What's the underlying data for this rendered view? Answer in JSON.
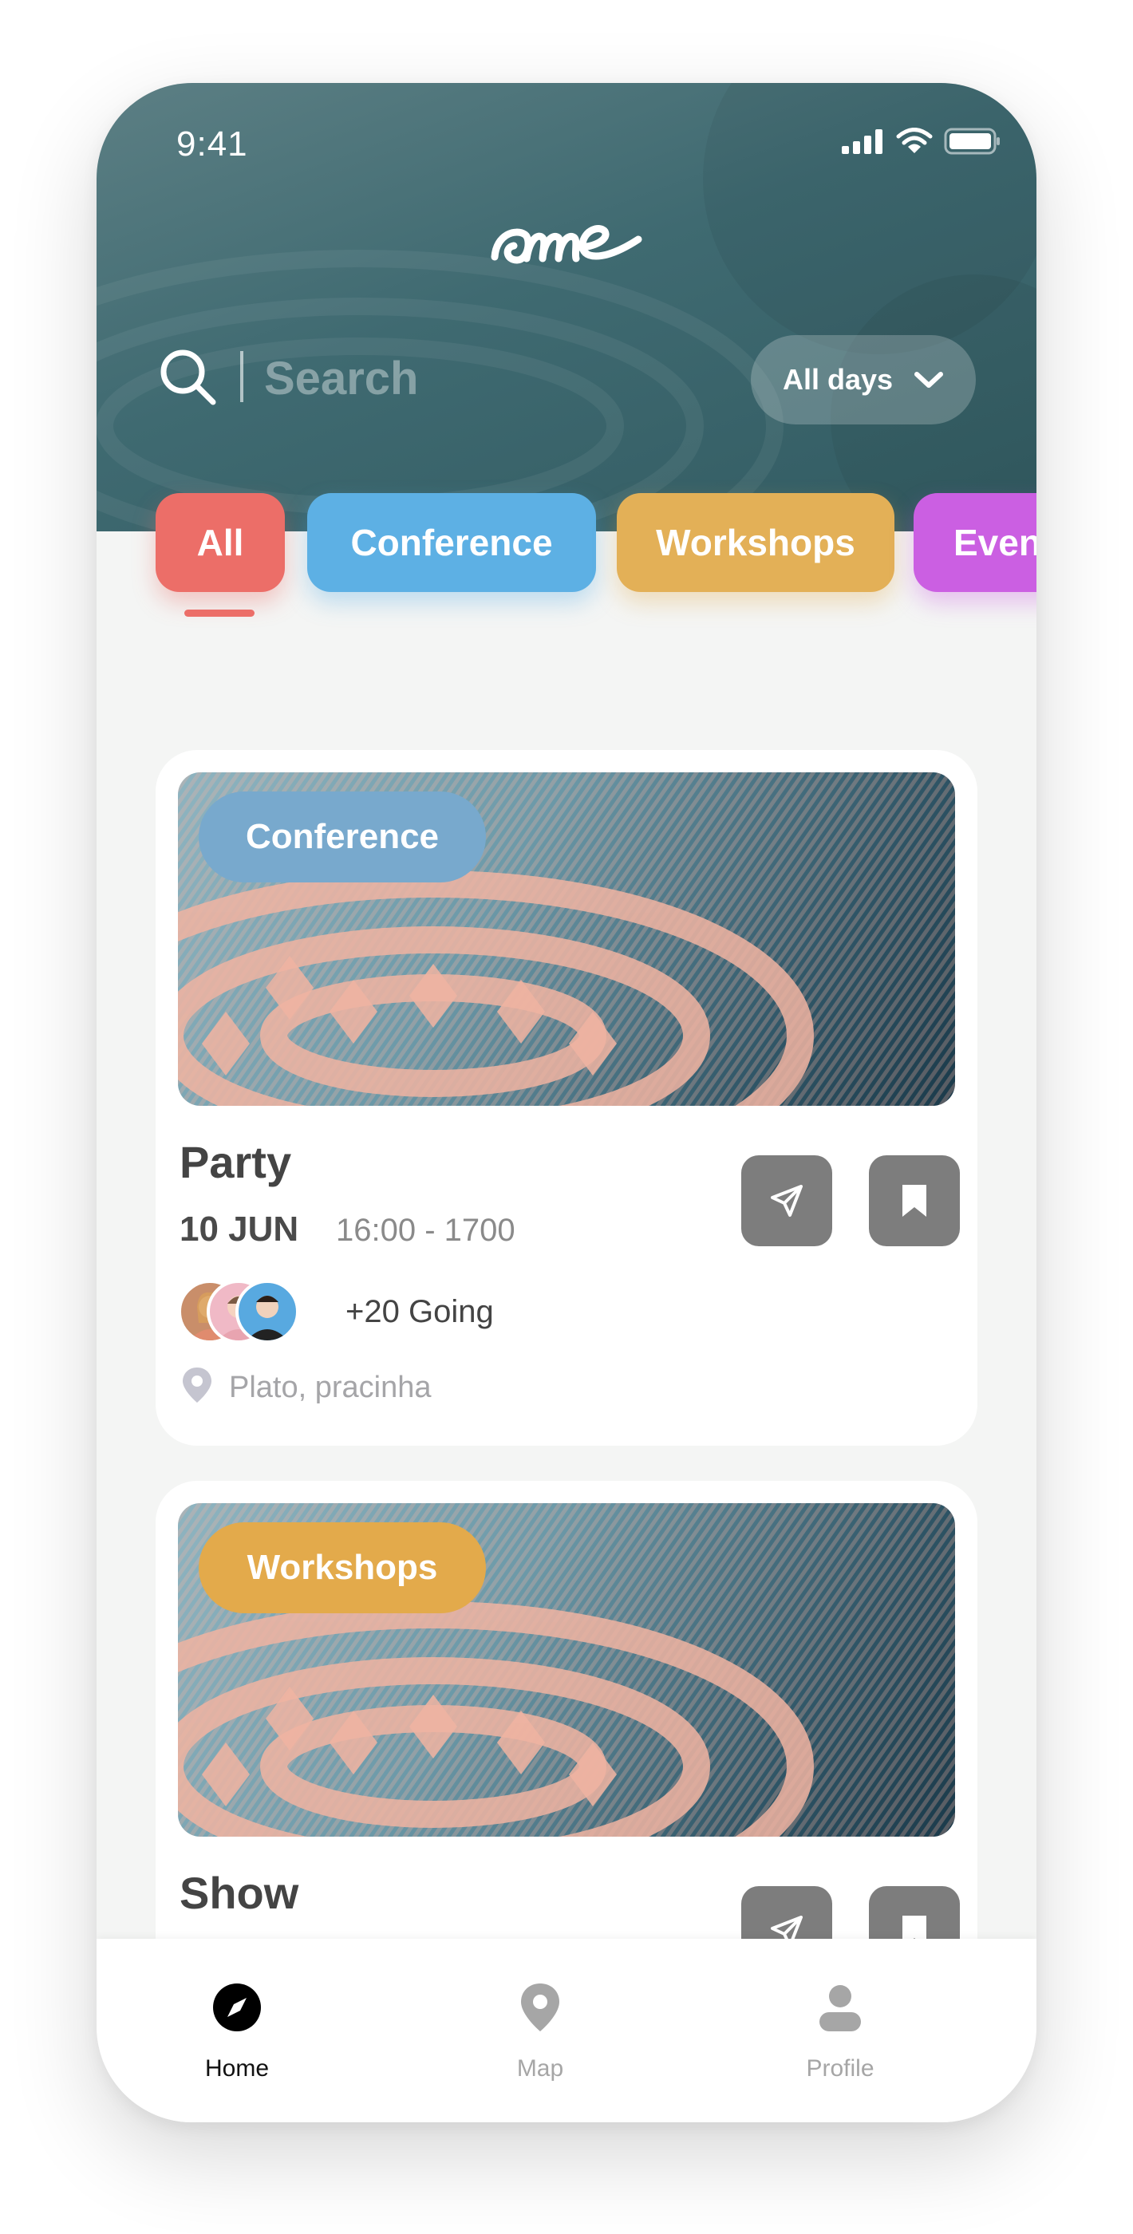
{
  "status_bar": {
    "time": "9:41"
  },
  "header": {
    "logo_text": "ame",
    "search": {
      "placeholder": "Search",
      "value": ""
    },
    "days_filter": {
      "label": "All days"
    }
  },
  "categories": [
    {
      "label": "All",
      "color": "#ec6e68",
      "selected": true
    },
    {
      "label": "Conference",
      "color": "#5db0e4"
    },
    {
      "label": "Workshops",
      "color": "#e3b057"
    },
    {
      "label": "Events",
      "color": "#cb5fe2"
    }
  ],
  "events": [
    {
      "category": "Conference",
      "title": "Party",
      "date": "10 JUN",
      "time": "16:00 - 1700",
      "going": "+20 Going",
      "location": "Plato, pracinha",
      "badge_color": "#78a9cd"
    },
    {
      "category": "Workshops",
      "title": "Show",
      "badge_color": "#e3aa4b"
    }
  ],
  "nav": {
    "items": [
      {
        "label": "Home",
        "icon": "compass-icon",
        "active": true
      },
      {
        "label": "Map",
        "icon": "map-pin-icon"
      },
      {
        "label": "Profile",
        "icon": "user-icon"
      }
    ]
  },
  "colors": {
    "header": "#3f6a71",
    "background": "#f4f5f4",
    "action_button": "#7d7d7d"
  }
}
